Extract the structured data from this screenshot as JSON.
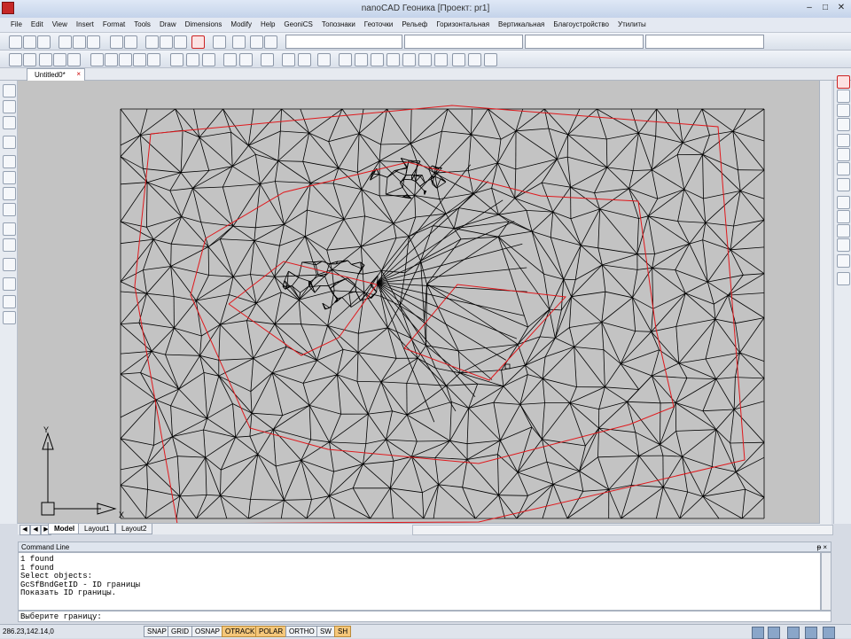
{
  "window": {
    "title": "nanoCAD Геоника [Проект: pr1]"
  },
  "menu": [
    "File",
    "Edit",
    "View",
    "Insert",
    "Format",
    "Tools",
    "Draw",
    "Dimensions",
    "Modify",
    "Help",
    "GeoniCS",
    "Топознаки",
    "Геоточки",
    "Рельеф",
    "Горизонтальная",
    "Вертикальная",
    "Благоустройство",
    "Утилиты"
  ],
  "doc_tab": {
    "label": "Untitled0*",
    "close": "×"
  },
  "layout_tabs": [
    "Model",
    "Layout1",
    "Layout2"
  ],
  "ucs": {
    "x_label": "X",
    "y_label": "Y"
  },
  "command_line": {
    "title": "Command Line",
    "pin": "ᵽ ×",
    "log": [
      "1 found",
      "1 found",
      "Select objects:",
      "GcSfBndGetID - ID границы",
      "Показать ID границы."
    ],
    "prompt": "Выберите границу:"
  },
  "status": {
    "coords": "286.23,142.14,0",
    "buttons": [
      {
        "label": "SNAP",
        "on": false
      },
      {
        "label": "GRID",
        "on": false
      },
      {
        "label": "OSNAP",
        "on": false
      },
      {
        "label": "OTRACK",
        "on": true
      },
      {
        "label": "POLAR",
        "on": true
      },
      {
        "label": "ORTHO",
        "on": false
      },
      {
        "label": "SW",
        "on": false
      },
      {
        "label": "SH",
        "on": true
      }
    ]
  },
  "colors": {
    "mesh": "#000000",
    "boundary": "#e0181c",
    "canvas": "#c3c3c3"
  }
}
